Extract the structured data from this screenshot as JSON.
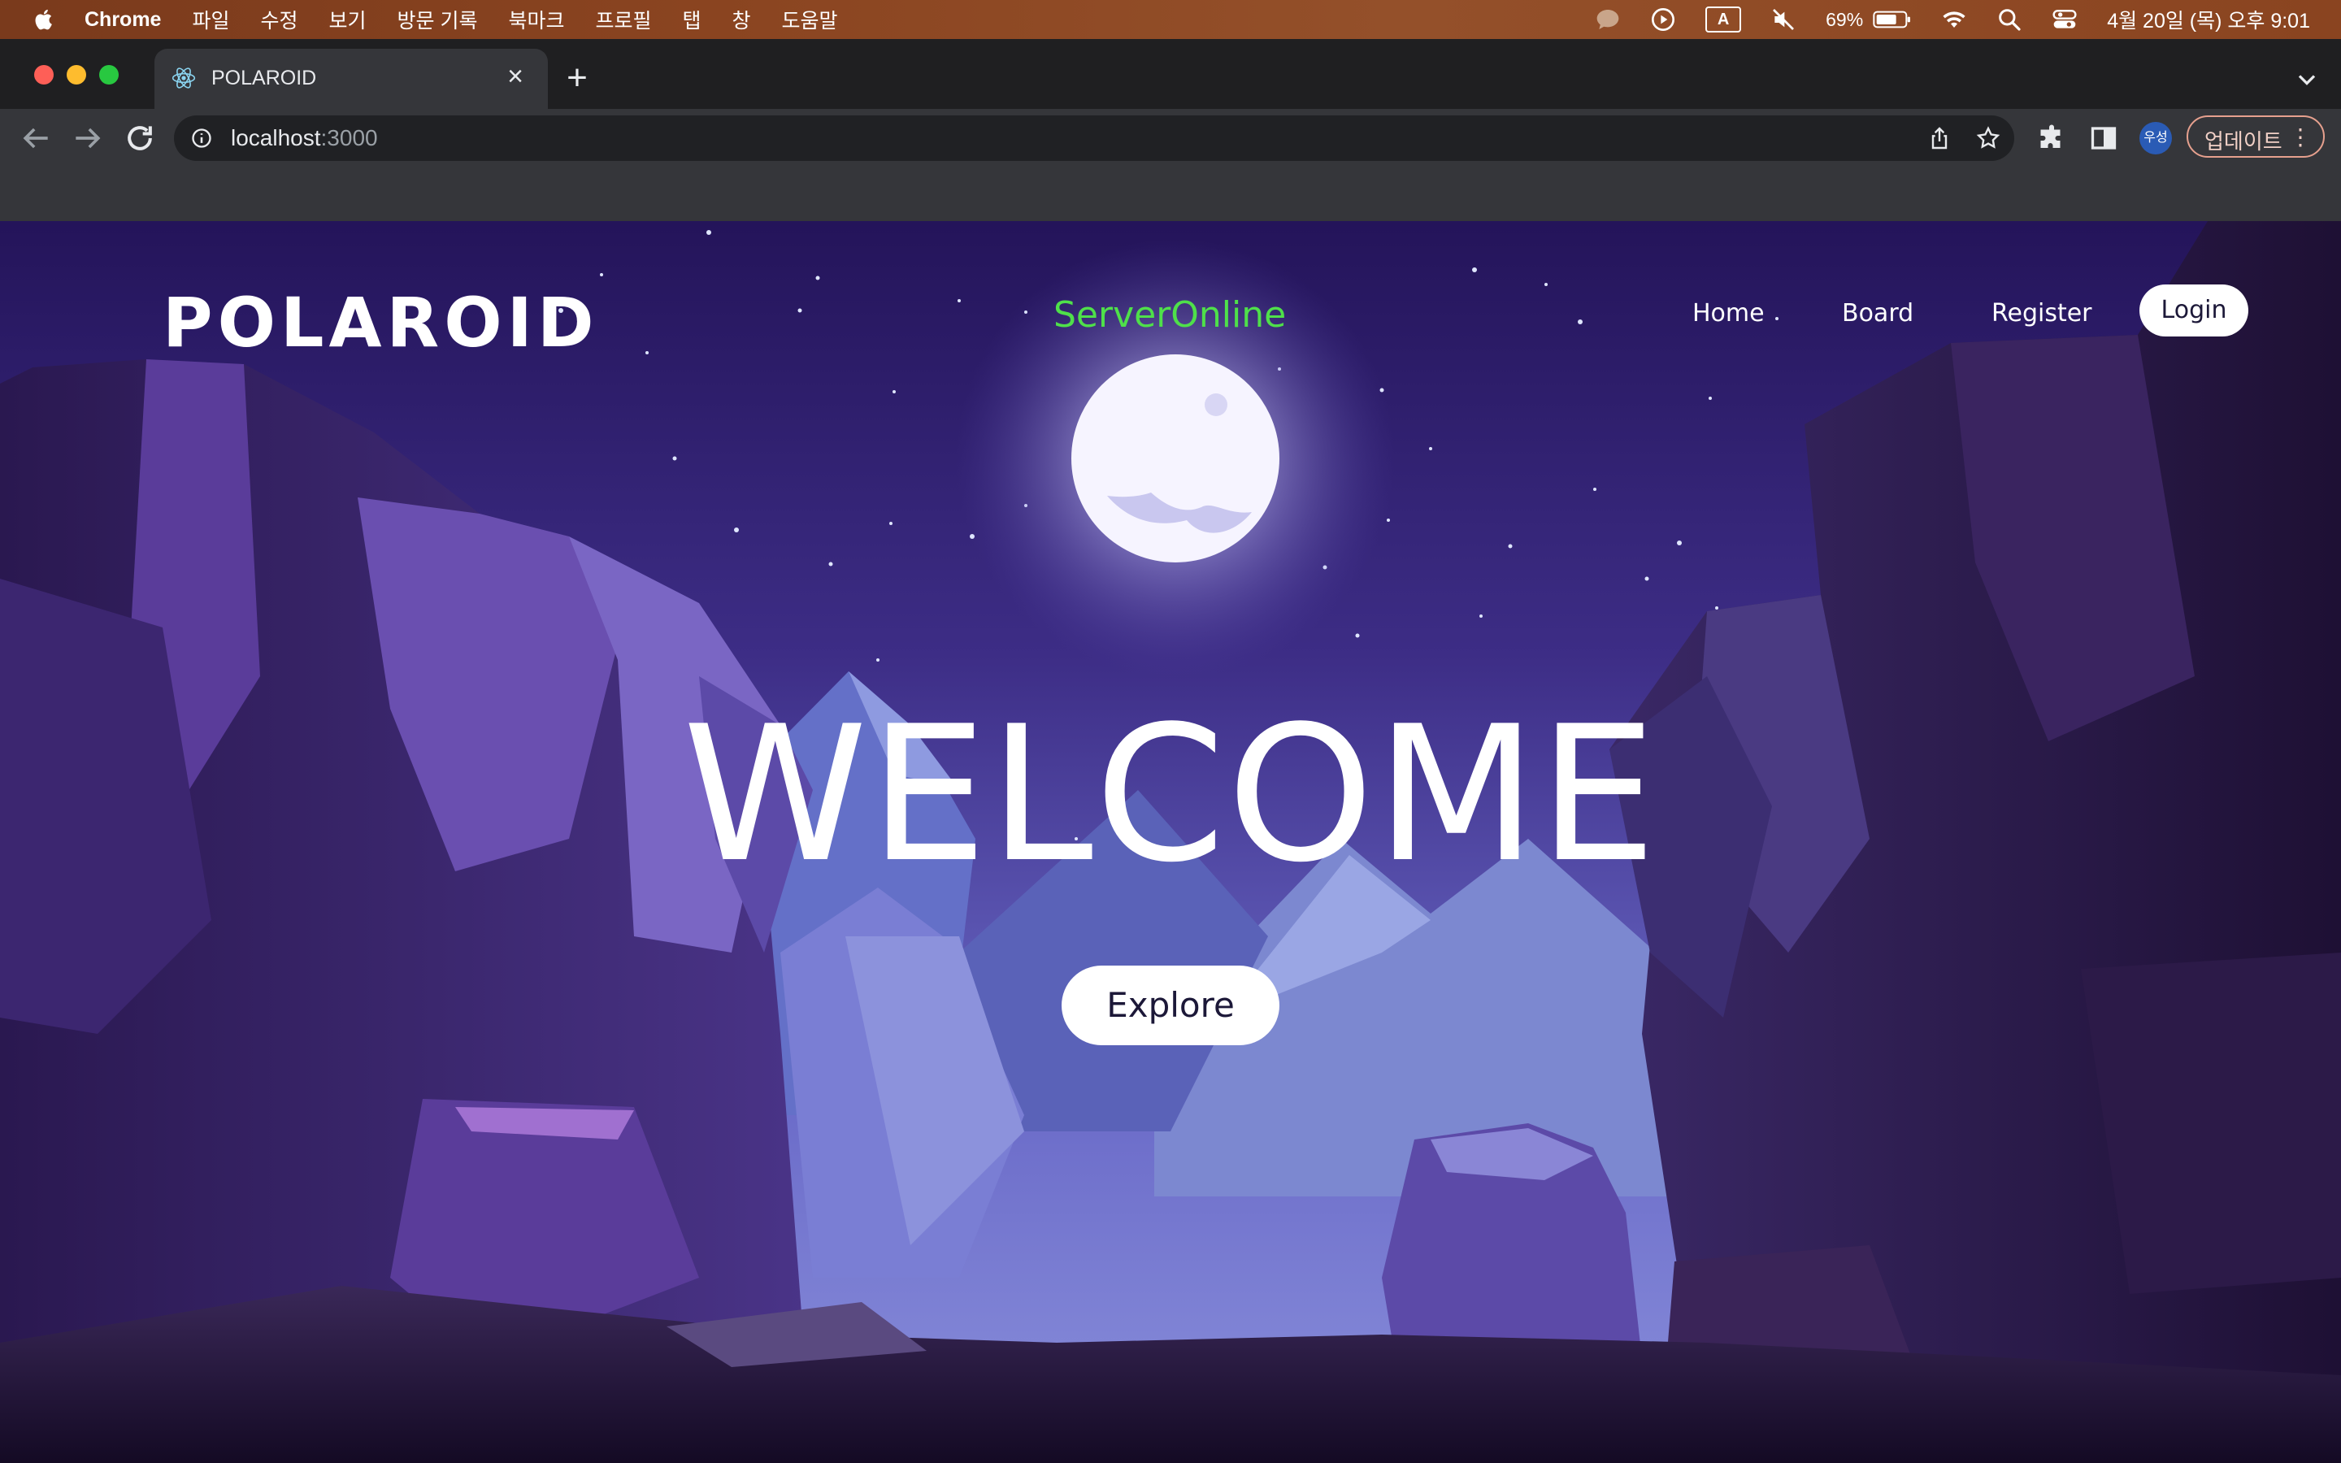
{
  "menubar": {
    "app_name": "Chrome",
    "items": [
      "파일",
      "수정",
      "보기",
      "방문 기록",
      "북마크",
      "프로필",
      "탭",
      "창",
      "도움말"
    ],
    "ime_label": "A",
    "battery": "69%",
    "datetime": "4월 20일 (목) 오후 9:01"
  },
  "browser": {
    "tab_title": "POLAROID",
    "url_host": "localhost",
    "url_port": ":3000",
    "profile_label": "우성",
    "update_label": "업데이트",
    "close_symbol": "×",
    "newtab_symbol": "+",
    "menu_symbol": "⋮"
  },
  "page": {
    "logo": "POLAROID",
    "server_status": "ServerOnline",
    "nav": {
      "home": "Home",
      "board": "Board",
      "register": "Register",
      "login": "Login"
    },
    "hero_title": "WELCOME",
    "hero_button": "Explore"
  },
  "colors": {
    "sky_top": "#2a1a5e",
    "sky_mid": "#4a3a9a",
    "server_online": "#4fe04a",
    "update_border": "#e6a08e"
  }
}
